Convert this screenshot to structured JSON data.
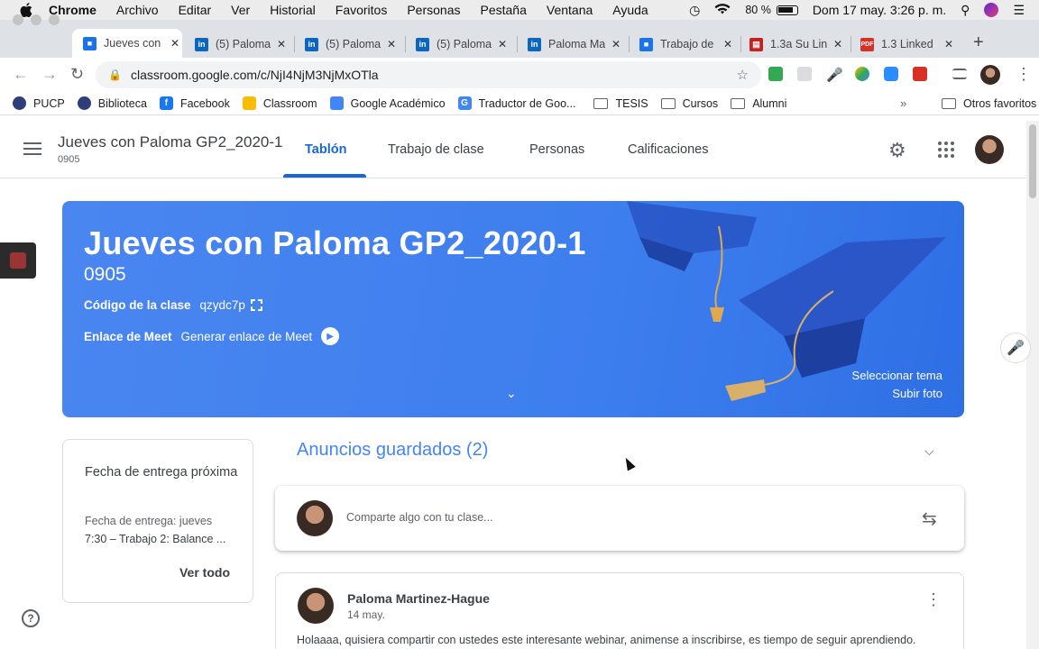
{
  "menubar": {
    "items": [
      "Chrome",
      "Archivo",
      "Editar",
      "Ver",
      "Historial",
      "Favoritos",
      "Personas",
      "Pestaña",
      "Ventana",
      "Ayuda"
    ],
    "battery": "80 %",
    "datetime": "Dom 17 may.  3:26 p. m."
  },
  "browser": {
    "tabs": [
      {
        "title": "Jueves con",
        "icon": "classroom-icon",
        "active": true
      },
      {
        "title": "(5) Paloma",
        "icon": "linkedin-icon"
      },
      {
        "title": "(5) Paloma",
        "icon": "linkedin-icon"
      },
      {
        "title": "(5) Paloma",
        "icon": "linkedin-icon"
      },
      {
        "title": "Paloma Ma",
        "icon": "linkedin-icon"
      },
      {
        "title": "Trabajo de",
        "icon": "classroom-icon"
      },
      {
        "title": "1.3a Su Lin",
        "icon": "slides-icon"
      },
      {
        "title": "1.3 Linked",
        "icon": "pdf-icon"
      }
    ],
    "url": "classroom.google.com/c/NjI4NjM3NjMxOTla",
    "bookmarks": [
      "PUCP",
      "Biblioteca",
      "Facebook",
      "Classroom",
      "Google Académico",
      "Traductor de Goo...",
      "TESIS",
      "Cursos",
      "Alumni"
    ],
    "other_bookmarks": "Otros favoritos"
  },
  "classroom": {
    "class_name": "Jueves con Paloma GP2_2020-1",
    "section": "0905",
    "nav_tabs": [
      "Tablón",
      "Trabajo de clase",
      "Personas",
      "Calificaciones"
    ],
    "banner": {
      "title": "Jueves con Paloma GP2_2020-1",
      "section": "0905",
      "code_label": "Código de la clase",
      "code_value": "qzydc7p",
      "meet_label": "Enlace de Meet",
      "meet_value": "Generar enlace de Meet",
      "select_theme": "Seleccionar tema",
      "upload_photo": "Subir foto"
    },
    "upcoming": {
      "title": "Fecha de entrega próxima",
      "line1": "Fecha de entrega: jueves",
      "line2": "7:30 – Trabajo 2: Balance ...",
      "view_all": "Ver todo"
    },
    "saved_announcements": "Anuncios guardados (2)",
    "share_placeholder": "Comparte algo con tu clase...",
    "post": {
      "author": "Paloma Martinez-Hague",
      "date": "14 may.",
      "text": "Holaaaa, quisiera compartir con ustedes este interesante webinar, animense a inscribirse, es tiempo de seguir aprendiendo."
    }
  },
  "colors": {
    "primary": "#1967d2",
    "banner": "#4285f4",
    "linkedin": "#0a66c2",
    "pdf": "#d93025"
  }
}
